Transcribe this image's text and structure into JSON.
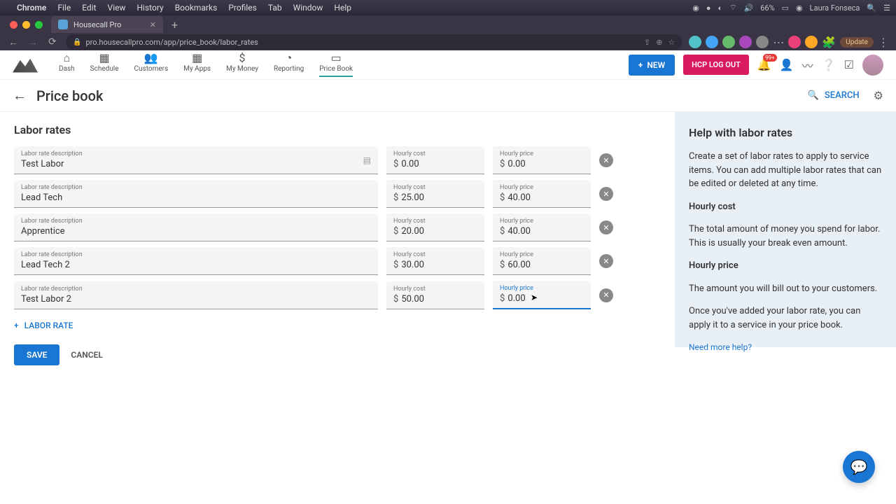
{
  "menubar": {
    "app": "Chrome",
    "items": [
      "File",
      "Edit",
      "View",
      "History",
      "Bookmarks",
      "Profiles",
      "Tab",
      "Window",
      "Help"
    ],
    "battery": "66%",
    "clock": "",
    "user": "Laura Fonseca"
  },
  "browser": {
    "tab_title": "Housecall Pro",
    "url": "pro.housecallpro.com/app/price_book/labor_rates",
    "update_label": "Update"
  },
  "header": {
    "nav": [
      {
        "label": "Dash",
        "icon": "⌂"
      },
      {
        "label": "Schedule",
        "icon": "▦"
      },
      {
        "label": "Customers",
        "icon": "👥"
      },
      {
        "label": "My Apps",
        "icon": "▦"
      },
      {
        "label": "My Money",
        "icon": "$"
      },
      {
        "label": "Reporting",
        "icon": "◔"
      },
      {
        "label": "Price Book",
        "icon": "▭"
      }
    ],
    "new_label": "NEW",
    "logout_label": "HCP LOG OUT",
    "notif_badge": "99+"
  },
  "page": {
    "title": "Price book",
    "search_label": "SEARCH"
  },
  "section": {
    "title": "Labor rates",
    "desc_label": "Labor rate description",
    "cost_label": "Hourly cost",
    "price_label": "Hourly price",
    "add_label": "LABOR RATE",
    "save_label": "SAVE",
    "cancel_label": "CANCEL"
  },
  "rates": [
    {
      "desc": "Test Labor",
      "cost": "0.00",
      "price": "0.00",
      "has_icon": true
    },
    {
      "desc": "Lead Tech",
      "cost": "25.00",
      "price": "40.00"
    },
    {
      "desc": "Apprentice",
      "cost": "20.00",
      "price": "40.00"
    },
    {
      "desc": "Lead Tech 2",
      "cost": "30.00",
      "price": "60.00"
    },
    {
      "desc": "Test Labor 2",
      "cost": "50.00",
      "price": "0.00",
      "price_focused": true
    }
  ],
  "help": {
    "title": "Help with labor rates",
    "intro": "Create a set of labor rates to apply to service items. You can add multiple labor rates that can be edited or deleted at any time.",
    "cost_h": "Hourly cost",
    "cost_p": "The total amount of money you spend for labor. This is usually your break even amount.",
    "price_h": "Hourly price",
    "price_p": "The amount you will bill out to your customers.",
    "apply": "Once you've added your labor rate, you can apply it to a service in your price book.",
    "link": "Need more help?"
  }
}
